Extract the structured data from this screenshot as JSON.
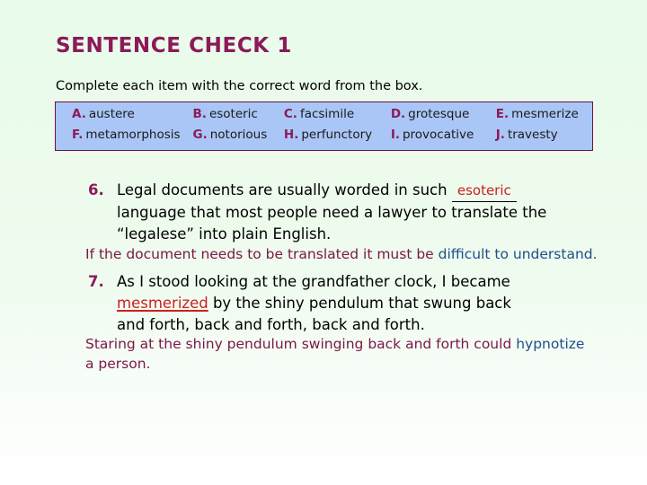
{
  "slide": {
    "title": "SENTENCE CHECK 1",
    "instruction": "Complete each item with the correct word from the box.",
    "colors": {
      "background_top": "#e8fbe9",
      "background_bottom": "#ffffff",
      "title": "#8c1a58",
      "wordbox_fill": "#a9c6f6",
      "wordbox_border": "#6b1446",
      "answer_red": "#cc2020",
      "answer_maroon": "#7a1746",
      "answer_blue": "#1f4e8c"
    }
  },
  "word_box": {
    "row1": [
      {
        "letter": "A.",
        "word": "austere"
      },
      {
        "letter": "B.",
        "word": "esoteric"
      },
      {
        "letter": "C.",
        "word": "facsimile"
      },
      {
        "letter": "D.",
        "word": "grotesque"
      },
      {
        "letter": "E.",
        "word": "mesmerize"
      }
    ],
    "row2": [
      {
        "letter": "F.",
        "word": "metamorphosis"
      },
      {
        "letter": "G.",
        "word": "notorious"
      },
      {
        "letter": "H.",
        "word": "perfunctory"
      },
      {
        "letter": "I.",
        "word": "provocative"
      },
      {
        "letter": "J.",
        "word": "travesty"
      }
    ]
  },
  "questions": [
    {
      "number": "6.",
      "line1_before": "Legal documents are usually worded in such",
      "filled_answer": "esoteric",
      "line2": "language that most people need a lawyer to translate the",
      "line3": "“legalese” into plain English.",
      "student_answer": {
        "maroon": "If the document needs to be translated it must be ",
        "blue": "difficult to understand."
      }
    },
    {
      "number": "7.",
      "line1": "As I stood looking at the grandfather clock, I became",
      "line2_answer": "mesmerized",
      "line2_after": "by the shiny pendulum that swung back",
      "line3": "and forth, back and forth, back and forth.",
      "student_answer": {
        "maroon_1": "Staring at the shiny pendulum swinging back and forth could ",
        "blue": "hypnotize",
        "maroon_2": "a person."
      }
    }
  ]
}
